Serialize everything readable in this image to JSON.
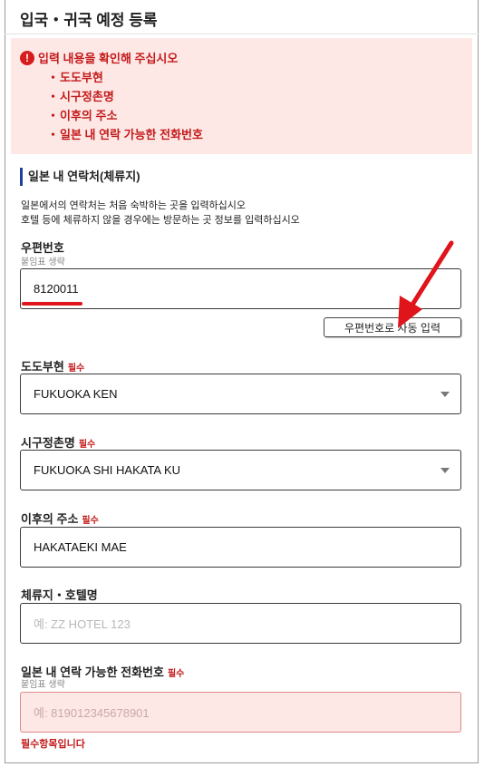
{
  "page": {
    "title": "입국・귀국 예정 등록"
  },
  "error_box": {
    "icon": "exclamation-icon",
    "title": "입력 내용을 확인해 주십시오",
    "items": [
      "도도부현",
      "시구정촌명",
      "이후의 주소",
      "일본 내 연락 가능한 전화번호"
    ]
  },
  "section": {
    "title": "일본 내 연락처(체류지)",
    "desc_line1": "일본에서의 연락처는 처음 숙박하는 곳을 입력하십시오",
    "desc_line2": "호텔 등에 체류하지 않을 경우에는 방문하는 곳 정보를 입력하십시오"
  },
  "postal": {
    "label": "우편번호",
    "sublabel": "붙임표 생략",
    "value": "8120011",
    "auto_button": "우편번호로 자동 입력"
  },
  "prefecture": {
    "label": "도도부현",
    "required": "필수",
    "value": "FUKUOKA KEN"
  },
  "city": {
    "label": "시구정촌명",
    "required": "필수",
    "value": "FUKUOKA SHI HAKATA KU"
  },
  "address": {
    "label": "이후의 주소",
    "required": "필수",
    "value": "HAKATAEKI MAE"
  },
  "hotel": {
    "label": "체류지・호텔명",
    "placeholder": "예: ZZ HOTEL 123"
  },
  "phone": {
    "label": "일본 내 연락 가능한 전화번호",
    "required": "필수",
    "sublabel": "붙임표 생략",
    "placeholder": "예: 819012345678901",
    "error": "필수항목입니다"
  },
  "colors": {
    "error_red": "#c41a1a",
    "error_bg": "#fde8e6",
    "section_bar": "#1f3f9e",
    "annotation_red": "#e0141b"
  }
}
